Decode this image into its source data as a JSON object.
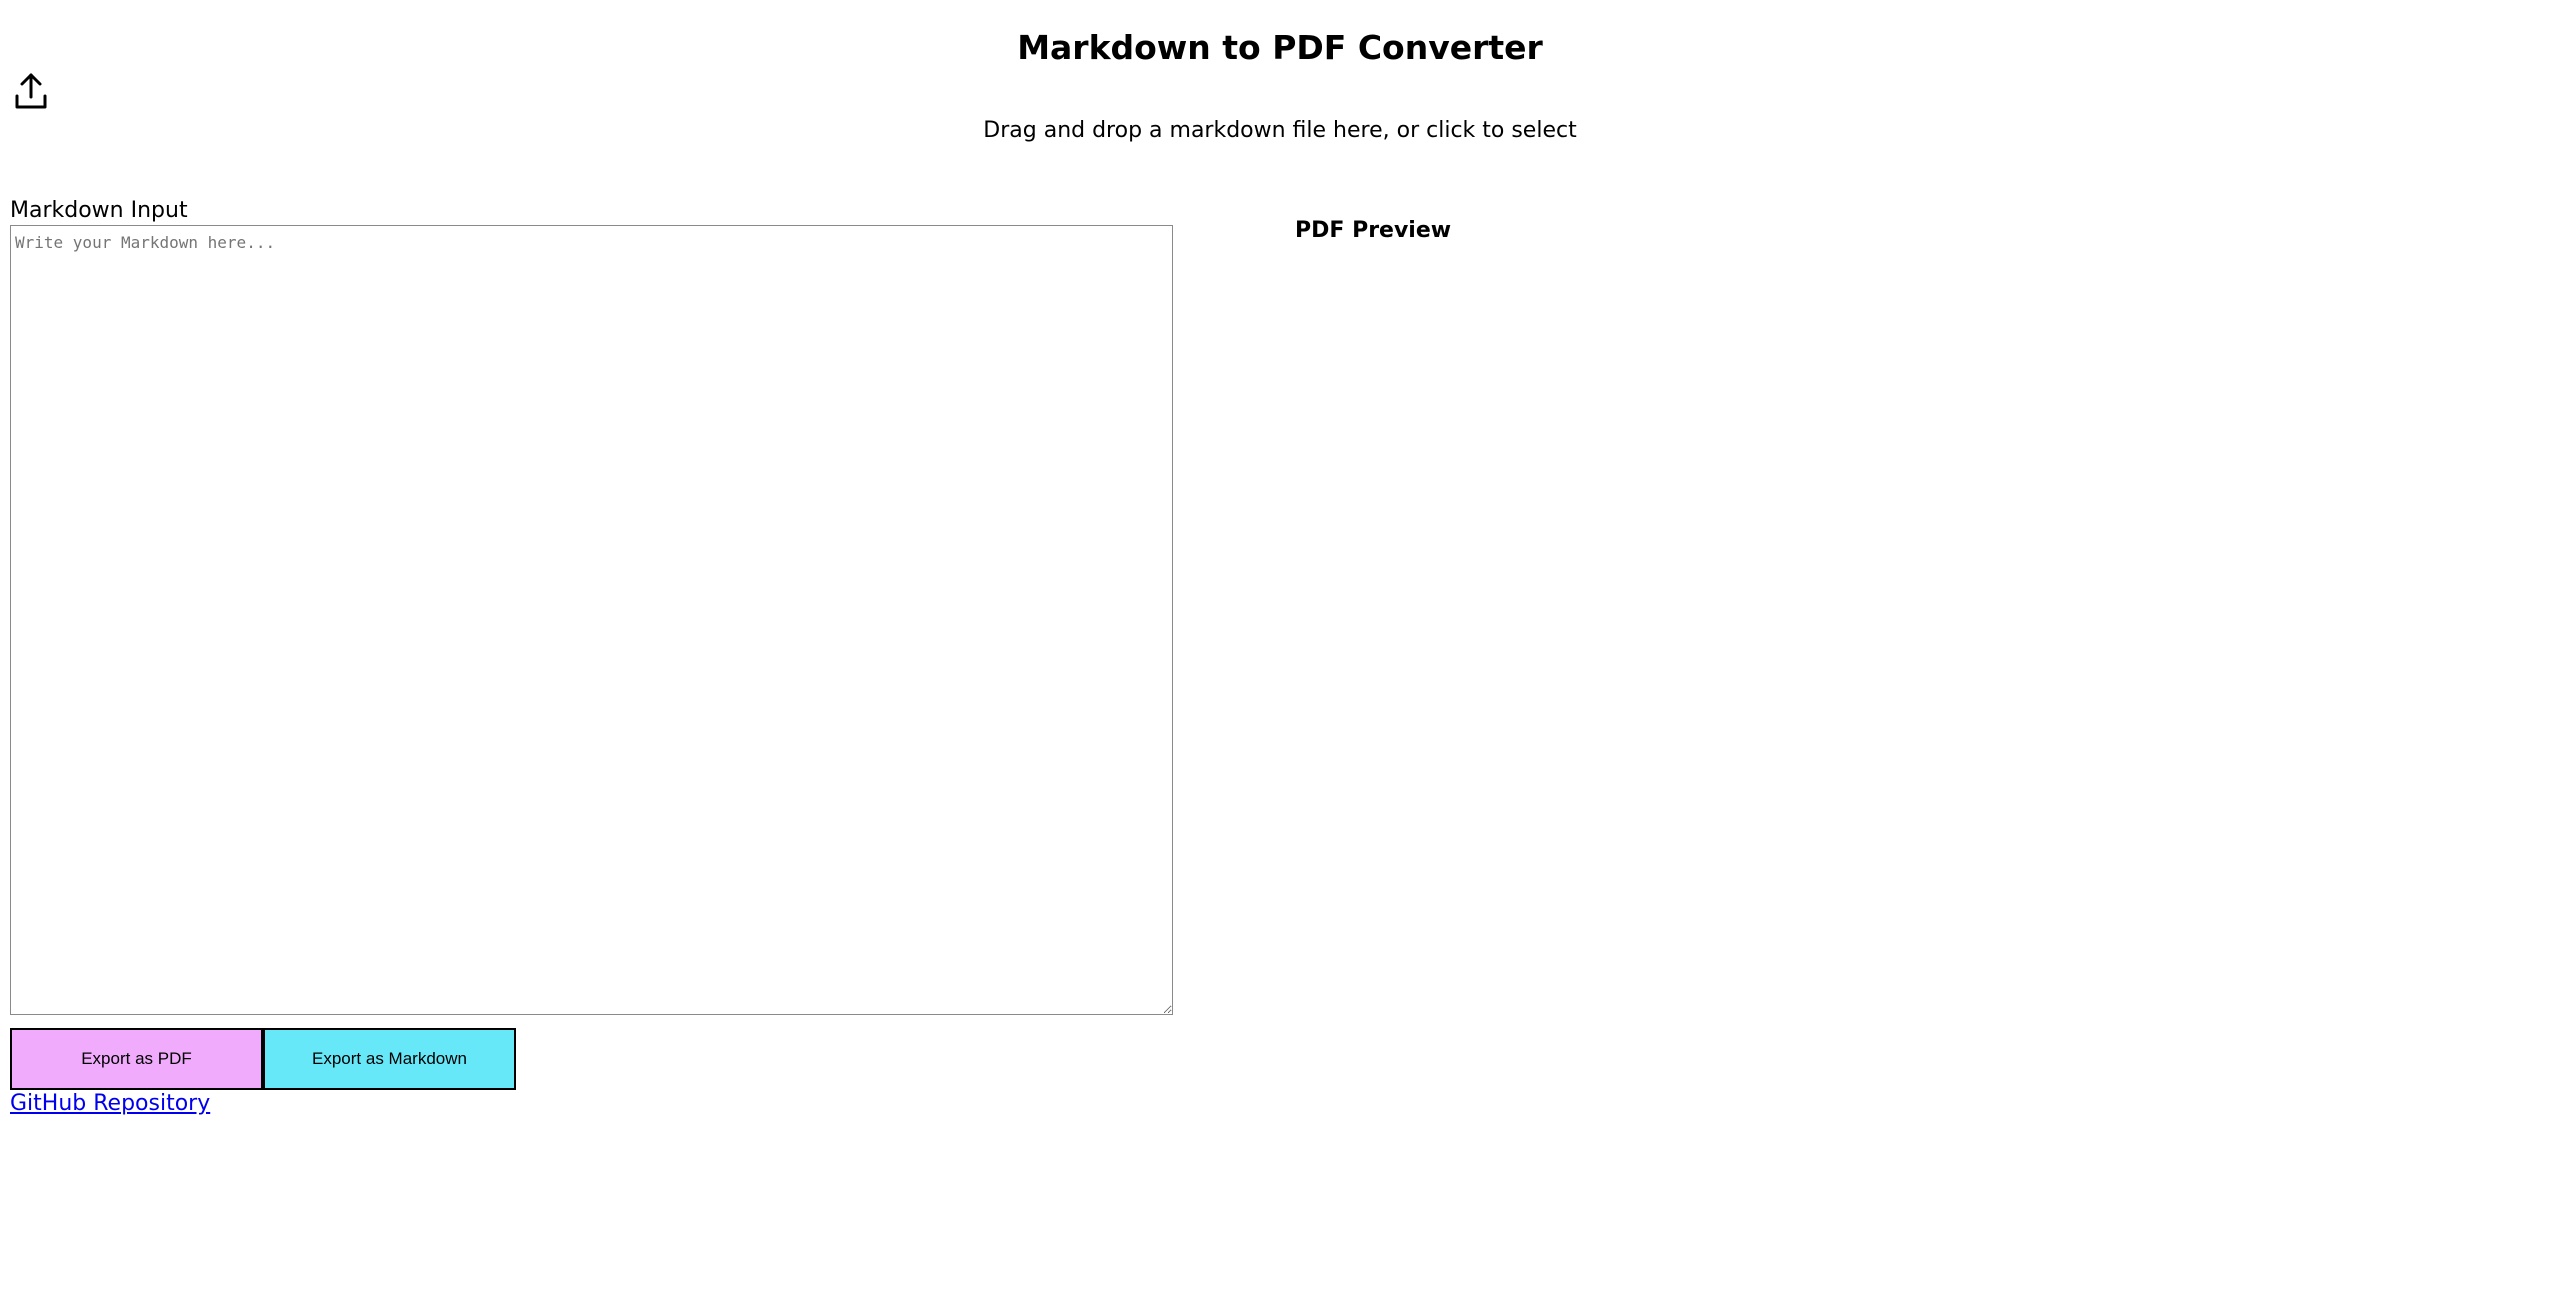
{
  "header": {
    "title": "Markdown to PDF Converter"
  },
  "upload": {
    "icon": "upload-icon",
    "hint": "Drag and drop a markdown file here, or click to select"
  },
  "editor": {
    "label": "Markdown Input",
    "value": "",
    "placeholder": "Write your Markdown here..."
  },
  "preview": {
    "label": "PDF Preview"
  },
  "actions": {
    "export_pdf_label": "Export as PDF",
    "export_pdf_color": "#f0abfc",
    "export_md_label": "Export as Markdown",
    "export_md_color": "#67e8f9"
  },
  "footer": {
    "repo_link": "GitHub Repository"
  }
}
